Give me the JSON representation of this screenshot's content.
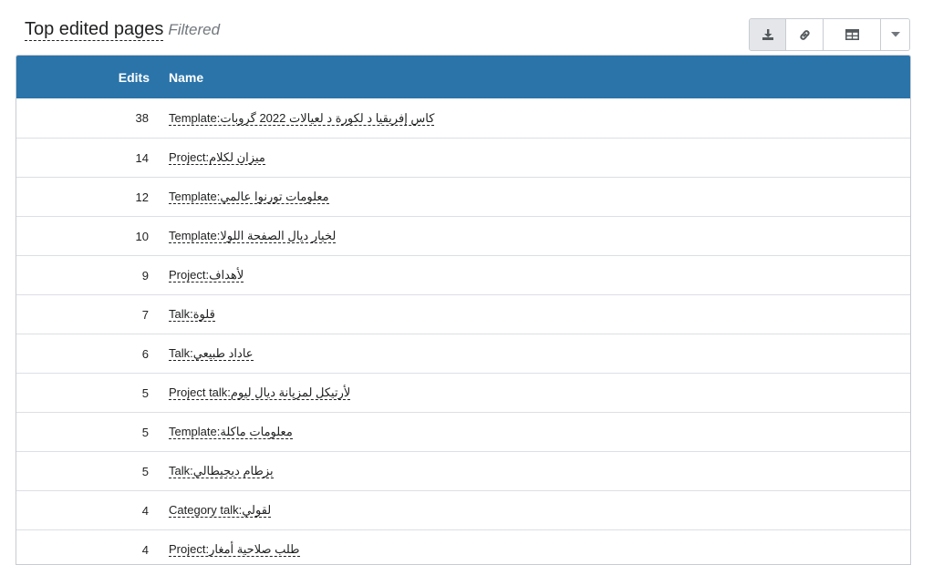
{
  "header": {
    "title": "Top edited pages",
    "subtitle": "Filtered"
  },
  "toolbar": {
    "icons": [
      "download-icon",
      "link-icon",
      "table-icon",
      "caret-down-icon"
    ]
  },
  "table": {
    "columns": {
      "edits": "Edits",
      "name": "Name"
    },
    "rows": [
      {
        "edits": "38",
        "name": "Template:كاس إفريقيا د لكورة د لعيالات 2022 گروبات"
      },
      {
        "edits": "14",
        "name": "Project:ميزان لكلام"
      },
      {
        "edits": "12",
        "name": "Template:معلومات تورنوا عالمي"
      },
      {
        "edits": "10",
        "name": "Template:لخيار ديال الصفحة اللولا"
      },
      {
        "edits": "9",
        "name": "Project:لأهداف"
      },
      {
        "edits": "7",
        "name": "Talk:قلوة"
      },
      {
        "edits": "6",
        "name": "Talk:عاداد طبيعي"
      },
      {
        "edits": "5",
        "name": "Project talk:لأرتيكل لمزيانة ديال ليوم"
      },
      {
        "edits": "5",
        "name": "Template:معلومات ماكلة"
      },
      {
        "edits": "5",
        "name": "Talk:بزطام ديجيطالي"
      },
      {
        "edits": "4",
        "name": "Category talk:لقولي"
      },
      {
        "edits": "4",
        "name": "Project:طلب صلاحية أمغار"
      }
    ]
  }
}
